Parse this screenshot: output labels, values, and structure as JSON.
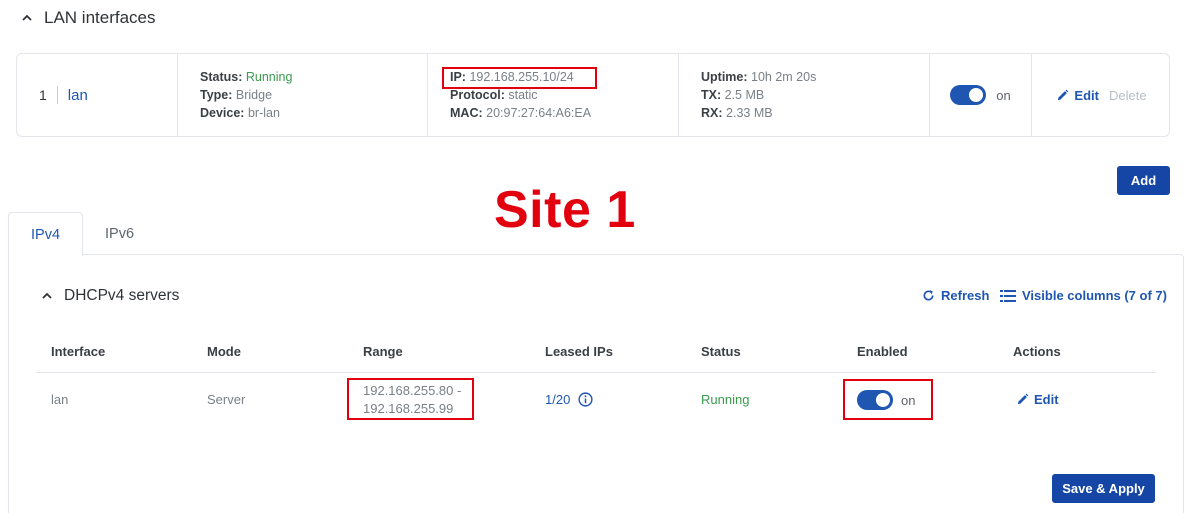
{
  "lan_section": {
    "title": "LAN interfaces",
    "row": {
      "index": "1",
      "name": "lan",
      "status_label": "Status:",
      "status_value": "Running",
      "type_label": "Type:",
      "type_value": "Bridge",
      "device_label": "Device:",
      "device_value": "br-lan",
      "ip_label": "IP:",
      "ip_value": "192.168.255.10/24",
      "protocol_label": "Protocol:",
      "protocol_value": "static",
      "mac_label": "MAC:",
      "mac_value": "20:97:27:64:A6:EA",
      "uptime_label": "Uptime:",
      "uptime_value": "10h 2m 20s",
      "tx_label": "TX:",
      "tx_value": "2.5 MB",
      "rx_label": "RX:",
      "rx_value": "2.33 MB",
      "toggle_text": "on",
      "edit_label": "Edit",
      "delete_label": "Delete"
    },
    "add_label": "Add"
  },
  "annotation": {
    "site_label": "Site 1",
    "highlight_color": "#e2000e"
  },
  "tabs": [
    {
      "label": "IPv4",
      "active": true
    },
    {
      "label": "IPv6",
      "active": false
    }
  ],
  "dhcp": {
    "title": "DHCPv4 servers",
    "refresh_label": "Refresh",
    "columns_label": "Visible columns (7 of 7)",
    "headers": [
      "Interface",
      "Mode",
      "Range",
      "Leased IPs",
      "Status",
      "Enabled",
      "Actions"
    ],
    "row": {
      "interface": "lan",
      "mode": "Server",
      "range_start": "192.168.255.80 -",
      "range_end": "192.168.255.99",
      "leased": "1/20",
      "status": "Running",
      "enabled_text": "on",
      "edit_label": "Edit"
    },
    "save_label": "Save & Apply"
  },
  "colors": {
    "accent": "#1f56b2",
    "button": "#1646a5",
    "running": "#3a9a4d"
  }
}
